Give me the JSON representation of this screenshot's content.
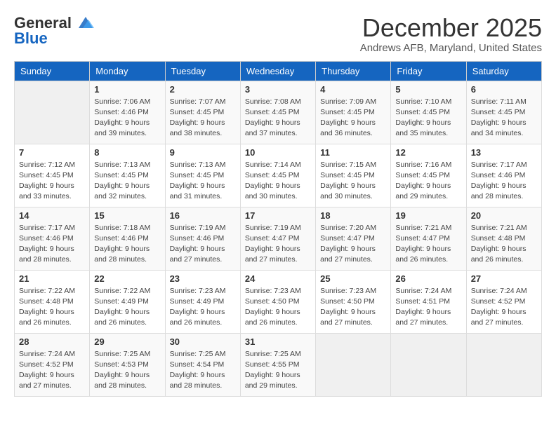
{
  "logo": {
    "general": "General",
    "blue": "Blue"
  },
  "title": "December 2025",
  "location": "Andrews AFB, Maryland, United States",
  "days_of_week": [
    "Sunday",
    "Monday",
    "Tuesday",
    "Wednesday",
    "Thursday",
    "Friday",
    "Saturday"
  ],
  "weeks": [
    [
      {
        "day": "",
        "sunrise": "",
        "sunset": "",
        "daylight": ""
      },
      {
        "day": "1",
        "sunrise": "Sunrise: 7:06 AM",
        "sunset": "Sunset: 4:46 PM",
        "daylight": "Daylight: 9 hours and 39 minutes."
      },
      {
        "day": "2",
        "sunrise": "Sunrise: 7:07 AM",
        "sunset": "Sunset: 4:45 PM",
        "daylight": "Daylight: 9 hours and 38 minutes."
      },
      {
        "day": "3",
        "sunrise": "Sunrise: 7:08 AM",
        "sunset": "Sunset: 4:45 PM",
        "daylight": "Daylight: 9 hours and 37 minutes."
      },
      {
        "day": "4",
        "sunrise": "Sunrise: 7:09 AM",
        "sunset": "Sunset: 4:45 PM",
        "daylight": "Daylight: 9 hours and 36 minutes."
      },
      {
        "day": "5",
        "sunrise": "Sunrise: 7:10 AM",
        "sunset": "Sunset: 4:45 PM",
        "daylight": "Daylight: 9 hours and 35 minutes."
      },
      {
        "day": "6",
        "sunrise": "Sunrise: 7:11 AM",
        "sunset": "Sunset: 4:45 PM",
        "daylight": "Daylight: 9 hours and 34 minutes."
      }
    ],
    [
      {
        "day": "7",
        "sunrise": "Sunrise: 7:12 AM",
        "sunset": "Sunset: 4:45 PM",
        "daylight": "Daylight: 9 hours and 33 minutes."
      },
      {
        "day": "8",
        "sunrise": "Sunrise: 7:13 AM",
        "sunset": "Sunset: 4:45 PM",
        "daylight": "Daylight: 9 hours and 32 minutes."
      },
      {
        "day": "9",
        "sunrise": "Sunrise: 7:13 AM",
        "sunset": "Sunset: 4:45 PM",
        "daylight": "Daylight: 9 hours and 31 minutes."
      },
      {
        "day": "10",
        "sunrise": "Sunrise: 7:14 AM",
        "sunset": "Sunset: 4:45 PM",
        "daylight": "Daylight: 9 hours and 30 minutes."
      },
      {
        "day": "11",
        "sunrise": "Sunrise: 7:15 AM",
        "sunset": "Sunset: 4:45 PM",
        "daylight": "Daylight: 9 hours and 30 minutes."
      },
      {
        "day": "12",
        "sunrise": "Sunrise: 7:16 AM",
        "sunset": "Sunset: 4:45 PM",
        "daylight": "Daylight: 9 hours and 29 minutes."
      },
      {
        "day": "13",
        "sunrise": "Sunrise: 7:17 AM",
        "sunset": "Sunset: 4:46 PM",
        "daylight": "Daylight: 9 hours and 28 minutes."
      }
    ],
    [
      {
        "day": "14",
        "sunrise": "Sunrise: 7:17 AM",
        "sunset": "Sunset: 4:46 PM",
        "daylight": "Daylight: 9 hours and 28 minutes."
      },
      {
        "day": "15",
        "sunrise": "Sunrise: 7:18 AM",
        "sunset": "Sunset: 4:46 PM",
        "daylight": "Daylight: 9 hours and 28 minutes."
      },
      {
        "day": "16",
        "sunrise": "Sunrise: 7:19 AM",
        "sunset": "Sunset: 4:46 PM",
        "daylight": "Daylight: 9 hours and 27 minutes."
      },
      {
        "day": "17",
        "sunrise": "Sunrise: 7:19 AM",
        "sunset": "Sunset: 4:47 PM",
        "daylight": "Daylight: 9 hours and 27 minutes."
      },
      {
        "day": "18",
        "sunrise": "Sunrise: 7:20 AM",
        "sunset": "Sunset: 4:47 PM",
        "daylight": "Daylight: 9 hours and 27 minutes."
      },
      {
        "day": "19",
        "sunrise": "Sunrise: 7:21 AM",
        "sunset": "Sunset: 4:47 PM",
        "daylight": "Daylight: 9 hours and 26 minutes."
      },
      {
        "day": "20",
        "sunrise": "Sunrise: 7:21 AM",
        "sunset": "Sunset: 4:48 PM",
        "daylight": "Daylight: 9 hours and 26 minutes."
      }
    ],
    [
      {
        "day": "21",
        "sunrise": "Sunrise: 7:22 AM",
        "sunset": "Sunset: 4:48 PM",
        "daylight": "Daylight: 9 hours and 26 minutes."
      },
      {
        "day": "22",
        "sunrise": "Sunrise: 7:22 AM",
        "sunset": "Sunset: 4:49 PM",
        "daylight": "Daylight: 9 hours and 26 minutes."
      },
      {
        "day": "23",
        "sunrise": "Sunrise: 7:23 AM",
        "sunset": "Sunset: 4:49 PM",
        "daylight": "Daylight: 9 hours and 26 minutes."
      },
      {
        "day": "24",
        "sunrise": "Sunrise: 7:23 AM",
        "sunset": "Sunset: 4:50 PM",
        "daylight": "Daylight: 9 hours and 26 minutes."
      },
      {
        "day": "25",
        "sunrise": "Sunrise: 7:23 AM",
        "sunset": "Sunset: 4:50 PM",
        "daylight": "Daylight: 9 hours and 27 minutes."
      },
      {
        "day": "26",
        "sunrise": "Sunrise: 7:24 AM",
        "sunset": "Sunset: 4:51 PM",
        "daylight": "Daylight: 9 hours and 27 minutes."
      },
      {
        "day": "27",
        "sunrise": "Sunrise: 7:24 AM",
        "sunset": "Sunset: 4:52 PM",
        "daylight": "Daylight: 9 hours and 27 minutes."
      }
    ],
    [
      {
        "day": "28",
        "sunrise": "Sunrise: 7:24 AM",
        "sunset": "Sunset: 4:52 PM",
        "daylight": "Daylight: 9 hours and 27 minutes."
      },
      {
        "day": "29",
        "sunrise": "Sunrise: 7:25 AM",
        "sunset": "Sunset: 4:53 PM",
        "daylight": "Daylight: 9 hours and 28 minutes."
      },
      {
        "day": "30",
        "sunrise": "Sunrise: 7:25 AM",
        "sunset": "Sunset: 4:54 PM",
        "daylight": "Daylight: 9 hours and 28 minutes."
      },
      {
        "day": "31",
        "sunrise": "Sunrise: 7:25 AM",
        "sunset": "Sunset: 4:55 PM",
        "daylight": "Daylight: 9 hours and 29 minutes."
      },
      {
        "day": "",
        "sunrise": "",
        "sunset": "",
        "daylight": ""
      },
      {
        "day": "",
        "sunrise": "",
        "sunset": "",
        "daylight": ""
      },
      {
        "day": "",
        "sunrise": "",
        "sunset": "",
        "daylight": ""
      }
    ]
  ]
}
